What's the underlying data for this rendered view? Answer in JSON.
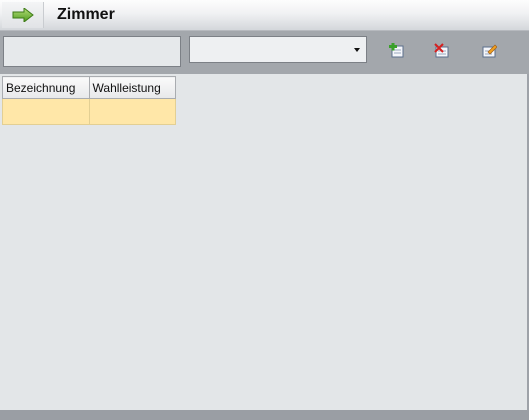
{
  "window": {
    "title": "Zimmer",
    "title_icon": "arrow-right-icon"
  },
  "toolbar": {
    "filter_value": "",
    "select_value": "",
    "buttons": [
      {
        "name": "add-icon"
      },
      {
        "name": "delete-icon"
      },
      {
        "name": "edit-icon"
      }
    ]
  },
  "grid": {
    "columns": [
      "Bezeichnung",
      "Wahlleistung"
    ],
    "rows": [
      [
        "",
        ""
      ]
    ]
  },
  "colors": {
    "selected_row": "#ffe7a8",
    "background": "#e3e6e8",
    "toolbar": "#a3a7ac"
  }
}
